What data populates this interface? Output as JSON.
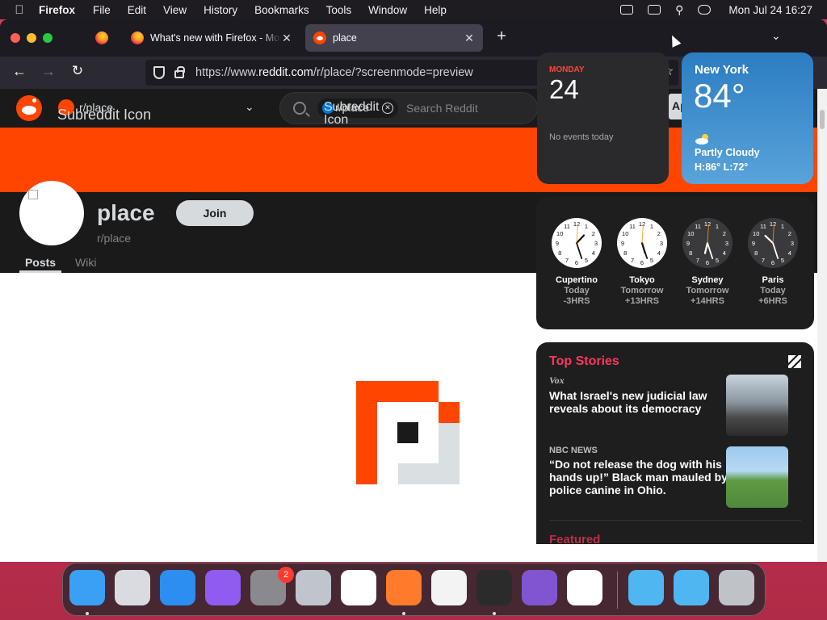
{
  "menubar": {
    "app_name": "Firefox",
    "items": [
      "File",
      "Edit",
      "View",
      "History",
      "Bookmarks",
      "Tools",
      "Window",
      "Help"
    ],
    "datetime": "Mon Jul 24  16:27"
  },
  "browser": {
    "tabs": [
      {
        "title": "What's new with Firefox - More"
      },
      {
        "title": "place"
      }
    ],
    "url_prefix": "https://www.",
    "url_domain": "reddit.com",
    "url_path": "/r/place/?screenmode=preview"
  },
  "reddit": {
    "header": {
      "subreddit_name": "r/place",
      "subreddit_icon_alt": "Subreddit Icon",
      "search_chip_text": "r/place",
      "search_chip_alt": "Subreddit Icon",
      "search_placeholder": "Search Reddit",
      "get_app_label": "Ap"
    },
    "community": {
      "title": "place",
      "handle": "r/place",
      "join_label": "Join",
      "tabs": [
        "Posts",
        "Wiki"
      ]
    },
    "colors": {
      "brand": "#ff4500",
      "dark": "#1a1a1b"
    }
  },
  "widgets": {
    "calendar": {
      "weekday": "MONDAY",
      "date": "24",
      "events": "No events today"
    },
    "weather": {
      "city": "New York",
      "temp": "84°",
      "condition": "Partly Cloudy",
      "hilo": "H:86° L:72°"
    },
    "clocks": [
      {
        "city": "Cupertino",
        "day": "Today",
        "offset": "-3HRS",
        "face": "light",
        "hour": 13.45,
        "minute": 27
      },
      {
        "city": "Tokyo",
        "day": "Tomorrow",
        "offset": "+13HRS",
        "face": "light",
        "hour": 5.45,
        "minute": 27
      },
      {
        "city": "Sydney",
        "day": "Tomorrow",
        "offset": "+14HRS",
        "face": "dark",
        "hour": 6.45,
        "minute": 27
      },
      {
        "city": "Paris",
        "day": "Today",
        "offset": "+6HRS",
        "face": "dark",
        "hour": 22.45,
        "minute": 27
      }
    ],
    "news": {
      "heading": "Top Stories",
      "stories": [
        {
          "source": "Vox",
          "headline": "What Israel's new judicial law reveals about its democracy"
        },
        {
          "source": "NBC NEWS",
          "headline": "“Do not release the dog with his hands up!” Black man mauled by police canine in Ohio."
        }
      ],
      "next_section": "Featured"
    }
  },
  "dock": {
    "apps": [
      {
        "name": "Finder",
        "color": "#3aa0f5"
      },
      {
        "name": "Launchpad",
        "color": "#d9dbe0"
      },
      {
        "name": "Safari",
        "color": "#2b8ef0"
      },
      {
        "name": "Podcasts-like",
        "color": "#8e5cf0"
      },
      {
        "name": "System Settings",
        "color": "#8a8a8e",
        "badge": "2"
      },
      {
        "name": "Automator",
        "color": "#c0c4cc"
      },
      {
        "name": "Freeform",
        "color": "#ffffff"
      },
      {
        "name": "Firefox",
        "color": "#ff7a2b"
      },
      {
        "name": "TextEdit",
        "color": "#f3f3f3"
      },
      {
        "name": "Terminal",
        "color": "#2b2b2b"
      },
      {
        "name": "Visual Studio",
        "color": "#8155d1"
      },
      {
        "name": "VS Code",
        "color": "#ffffff"
      },
      {
        "name": "Folder",
        "color": "#4fb6f2"
      },
      {
        "name": "Folder",
        "color": "#4fb6f2"
      },
      {
        "name": "Trash",
        "color": "#bfc2c6"
      }
    ]
  }
}
